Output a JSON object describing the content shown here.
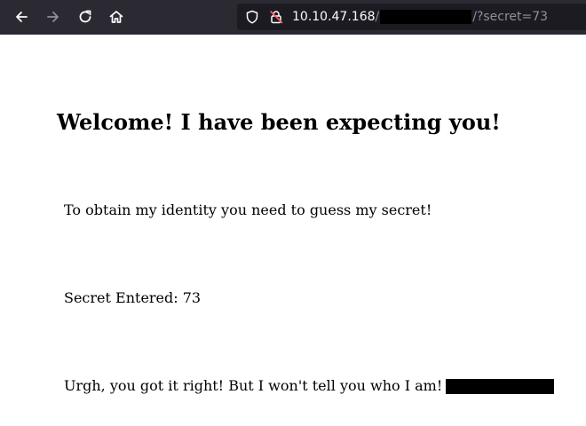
{
  "browser": {
    "back_icon": "arrow-left-icon",
    "forward_icon": "arrow-right-icon",
    "reload_icon": "reload-icon",
    "home_icon": "home-icon",
    "url_host": "10.10.47.168",
    "url_slash": "/",
    "url_query": "/?secret=73",
    "tracking_icon": "shield-icon",
    "security_icon": "insecure-lock-icon"
  },
  "page": {
    "heading": "Welcome! I have been expecting you!",
    "instruction": "To obtain my identity you need to guess my secret!",
    "secret_entered": "Secret Entered: 73",
    "result": "Urgh, you got it right! But I won't tell you who I am!"
  },
  "colors": {
    "toolbar": "#2b2a33",
    "urlbar": "#1c1b22",
    "url_text": "#fbfbfe",
    "url_dim": "#8f8f9d"
  }
}
